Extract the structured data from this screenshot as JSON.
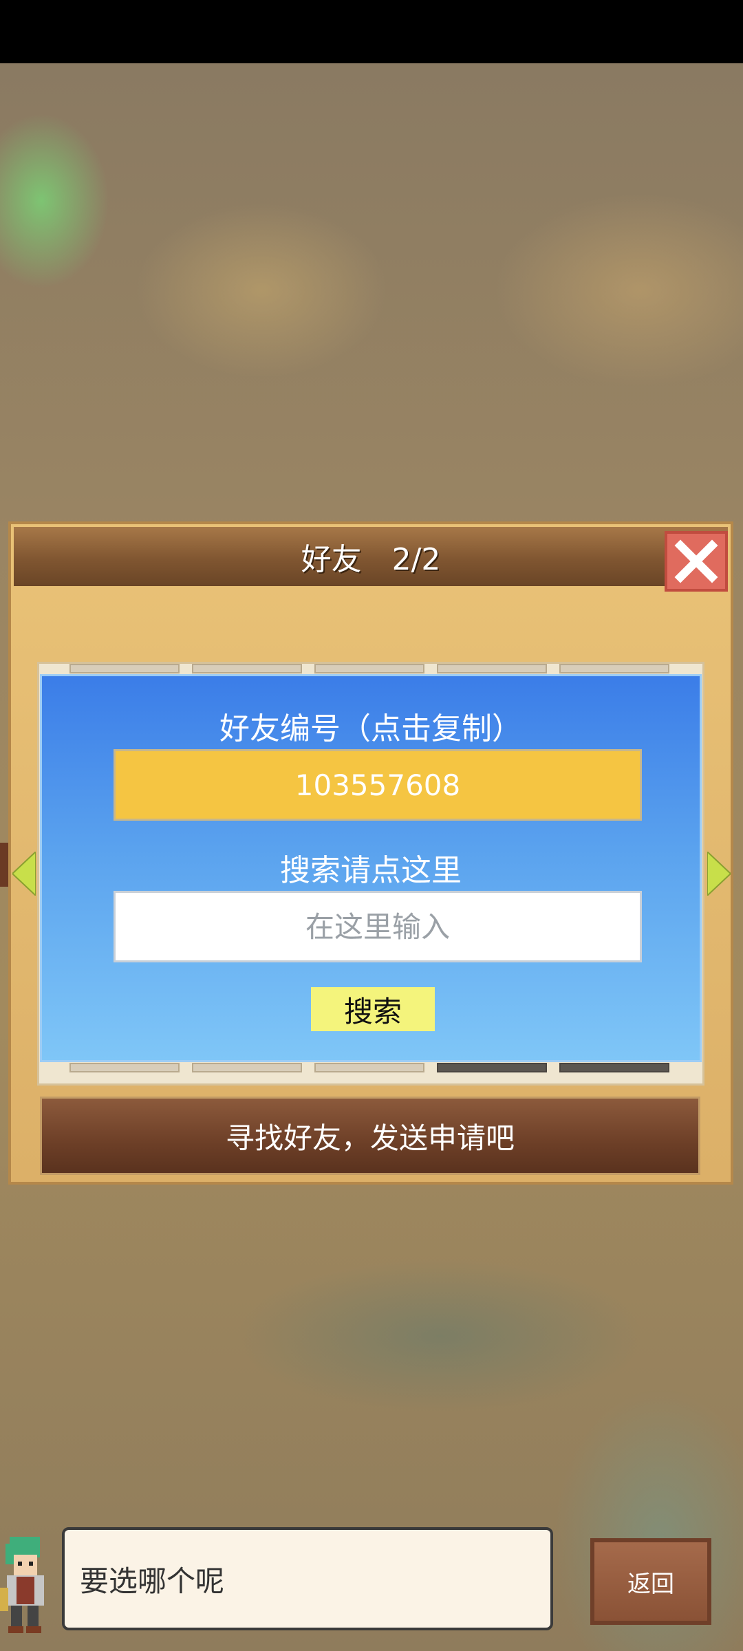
{
  "dialog": {
    "title": "好友　2/2"
  },
  "friend_code": {
    "label": "好友编号（点击复制）",
    "value": "103557608"
  },
  "search": {
    "label": "搜索请点这里",
    "placeholder": "在这里输入",
    "button_label": "搜索"
  },
  "footer_button": {
    "label": "寻找好友，发送申请吧"
  },
  "bottom_bar": {
    "speech_text": "要选哪个呢",
    "back_label": "返回"
  },
  "colors": {
    "accent_yellow": "#f5c542",
    "panel_blue": "#3b7de8",
    "close_red": "#e06b5e",
    "button_brown": "#6d3f27"
  },
  "icons": [
    "close-icon",
    "arrow-left-icon",
    "arrow-right-icon",
    "character-avatar-icon"
  ]
}
